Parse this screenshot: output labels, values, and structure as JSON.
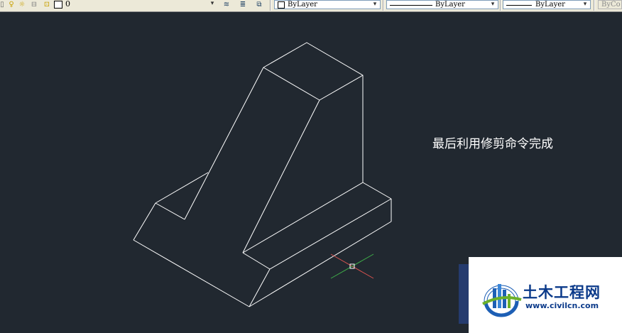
{
  "toolbar": {
    "layer_name": "0",
    "color_value": "ByLayer",
    "linetype_value": "ByLayer",
    "lineweight_value": "ByLayer",
    "plotstyle_value": "ByCo",
    "dropdown_glyph": "▾",
    "icons": [
      "layer-state-icon",
      "bulb-icon",
      "sun-freeze-icon",
      "lock-icon",
      "layer-color-icon",
      "make-current-icon",
      "layer-previous-icon",
      "layer-match-icon"
    ]
  },
  "drawing": {
    "annotation": "最后利用修剪命令完成",
    "line_color": "#ffffff",
    "background_color": "#212830",
    "crosshair_colors": {
      "x_axis": "#d9534f",
      "y_axis": "#3fae49"
    }
  },
  "watermark": {
    "title": "土木工程网",
    "url": "www.civilcn.com"
  }
}
